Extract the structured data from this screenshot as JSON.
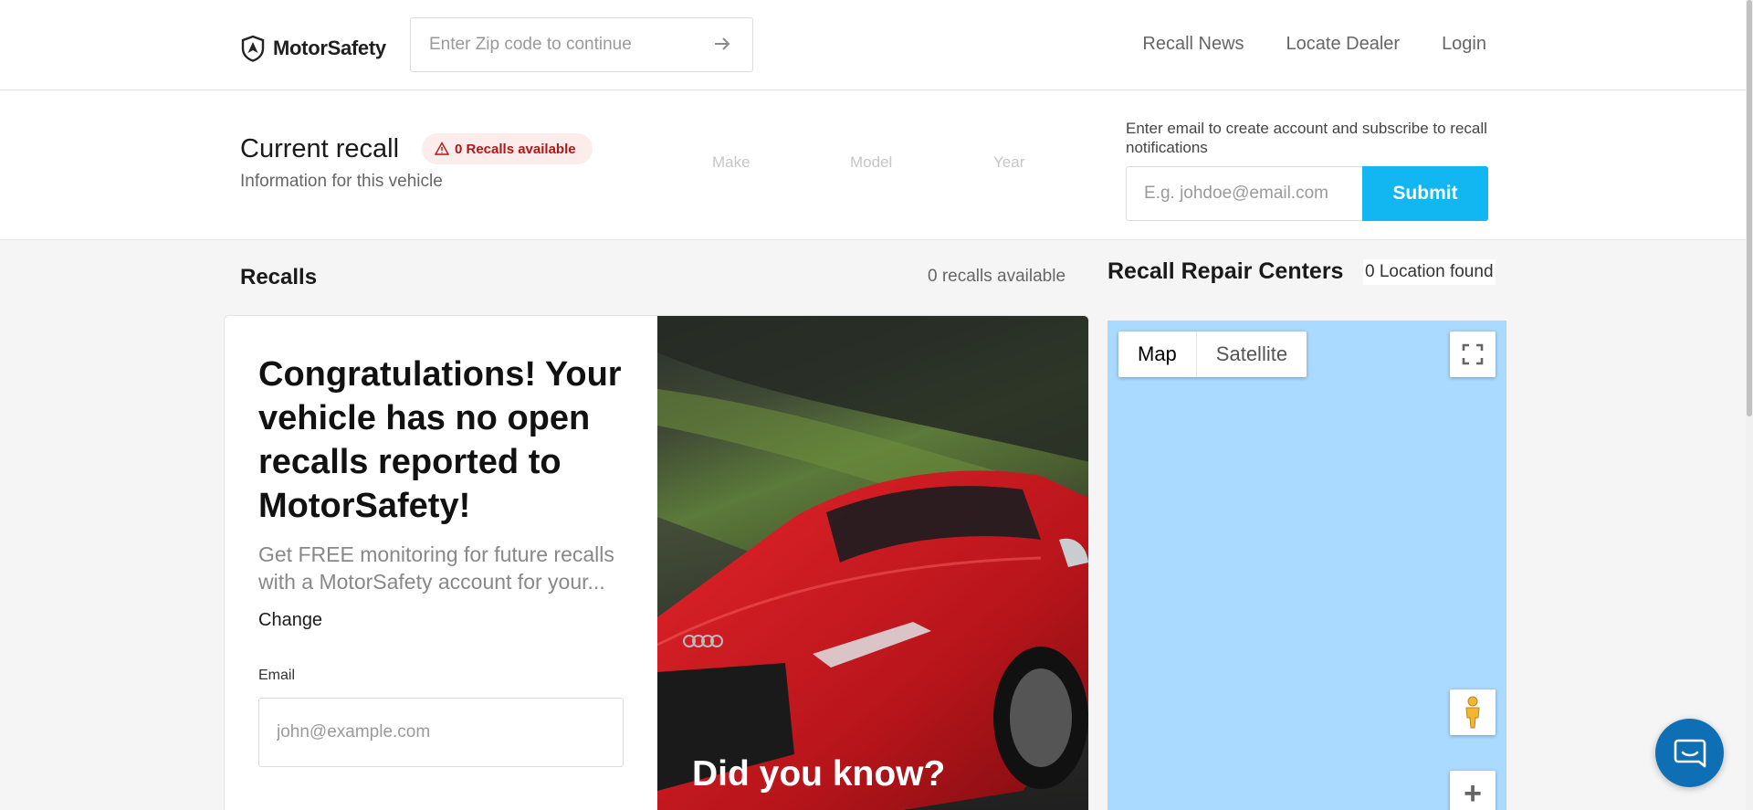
{
  "header": {
    "brand": "MotorSafety",
    "zip_placeholder": "Enter Zip code to continue",
    "nav": [
      "Recall News",
      "Locate Dealer",
      "Login"
    ]
  },
  "current_recall": {
    "title": "Current recall",
    "subtitle": "Information for this vehicle",
    "badge": "0 Recalls available",
    "vehicle_fields": [
      "Make",
      "Model",
      "Year"
    ],
    "subscribe_label": "Enter email to create account and subscribe to recall notifications",
    "email_placeholder": "E.g. johdoe@email.com",
    "submit_label": "Submit"
  },
  "recalls": {
    "title": "Recalls",
    "count_text": "0 recalls available",
    "card": {
      "headline": "Congratulations! Your vehicle has no open recalls reported to MotorSafety!",
      "monitor_text": "Get FREE monitoring for future recalls with a MotorSafety account for your...",
      "change_label": "Change",
      "email_label": "Email",
      "email_placeholder": "john@example.com",
      "image_caption": "Did you know?"
    }
  },
  "repair_centers": {
    "title": "Recall Repair Centers",
    "count_text": "0 Location found",
    "map_types": [
      "Map",
      "Satellite"
    ],
    "zoom_in": "+"
  },
  "colors": {
    "accent": "#12b6f0",
    "badge_bg": "#fdecec",
    "badge_text": "#b01717",
    "map_water": "#aadaff",
    "chat": "#0f6fb5"
  },
  "icons": [
    "shield-logo-icon",
    "arrow-right-icon",
    "warning-icon",
    "fullscreen-icon",
    "pegman-icon",
    "chat-icon"
  ]
}
